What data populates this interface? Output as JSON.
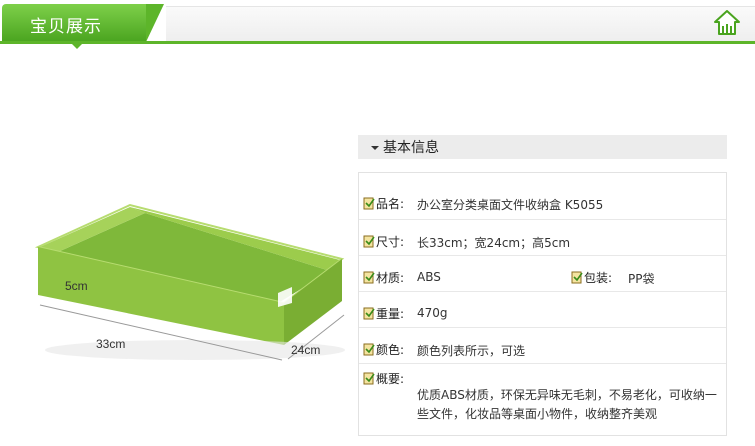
{
  "header": {
    "title": "宝贝展示",
    "home_icon": "home-icon"
  },
  "product_image": {
    "dimension_labels": {
      "height": "5cm",
      "length": "33cm",
      "width": "24cm"
    },
    "tray_color": "#8bc53f"
  },
  "info": {
    "section_title": "基本信息",
    "rows": [
      {
        "label": "品名:",
        "value": "办公室分类桌面文件收纳盒 K5055"
      },
      {
        "label": "尺寸:",
        "value": "长33cm；宽24cm；高5cm"
      },
      {
        "label": "材质:",
        "value": "ABS",
        "label2": "包装:",
        "value2": "PP袋"
      },
      {
        "label": "重量:",
        "value": "470g"
      },
      {
        "label": "颜色:",
        "value": "颜色列表所示，可选"
      },
      {
        "label": "概要:",
        "value_line1": "优质ABS材质，环保无异味无毛刺，不易老化，可收纳一",
        "value_line2": "些文件，化妆品等桌面小物件，收纳整齐美观"
      }
    ]
  }
}
